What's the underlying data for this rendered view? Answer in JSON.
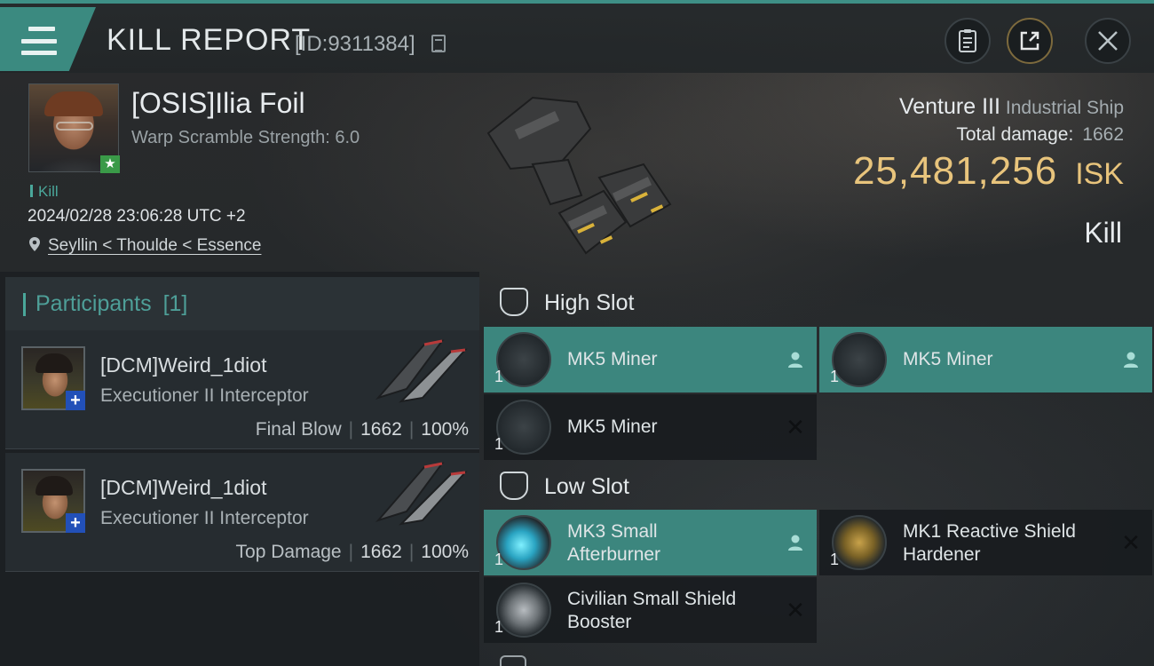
{
  "header": {
    "title": "KILL REPORT",
    "report_id": "[ID:9311384]"
  },
  "victim": {
    "name": "[OSIS]Ilia Foil",
    "warp_scramble": "Warp Scramble Strength: 6.0",
    "kill_tag": "Kill",
    "timestamp": "2024/02/28 23:06:28 UTC +2",
    "location": "Seyllin < Thoulde < Essence",
    "ship_name": "Venture III",
    "ship_class": "Industrial Ship",
    "total_damage_label": "Total damage:",
    "total_damage_value": "1662",
    "isk_amount": "25,481,256",
    "isk_unit": "ISK",
    "result": "Kill"
  },
  "participants": {
    "header_label": "Participants",
    "header_count": "[1]",
    "items": [
      {
        "name": "[DCM]Weird_1diot",
        "ship": "Executioner II Interceptor",
        "role": "Final Blow",
        "damage": "1662",
        "percent": "100%"
      },
      {
        "name": "[DCM]Weird_1diot",
        "ship": "Executioner II Interceptor",
        "role": "Top Damage",
        "damage": "1662",
        "percent": "100%"
      }
    ]
  },
  "fitting": {
    "high_slot_label": "High Slot",
    "low_slot_label": "Low Slot",
    "high_modules": [
      {
        "line1": "MK5 Miner",
        "line2": "",
        "qty": "1",
        "status": "dropped"
      },
      {
        "line1": "MK5 Miner",
        "line2": "",
        "qty": "1",
        "status": "dropped"
      },
      {
        "line1": "MK5 Miner",
        "line2": "",
        "qty": "1",
        "status": "destroyed"
      }
    ],
    "low_modules": [
      {
        "line1": "MK3 Small",
        "line2": "Afterburner",
        "qty": "1",
        "status": "dropped"
      },
      {
        "line1": "MK1 Reactive Shield",
        "line2": "Hardener",
        "qty": "1",
        "status": "destroyed"
      },
      {
        "line1": "Civilian Small Shield",
        "line2": "Booster",
        "qty": "1",
        "status": "destroyed"
      }
    ]
  },
  "colors": {
    "accent_teal": "#3c867e",
    "isk_gold": "#e8c47c",
    "highlight_teal_text": "#4aa79a"
  },
  "icons": {
    "menu": "hamburger-menu-icon",
    "copy": "copy-icon",
    "document": "document-icon",
    "share": "share-icon",
    "close": "close-icon",
    "location": "map-pin-icon",
    "slot": "slot-icon",
    "dropped": "person-icon",
    "destroyed": "x-icon"
  }
}
